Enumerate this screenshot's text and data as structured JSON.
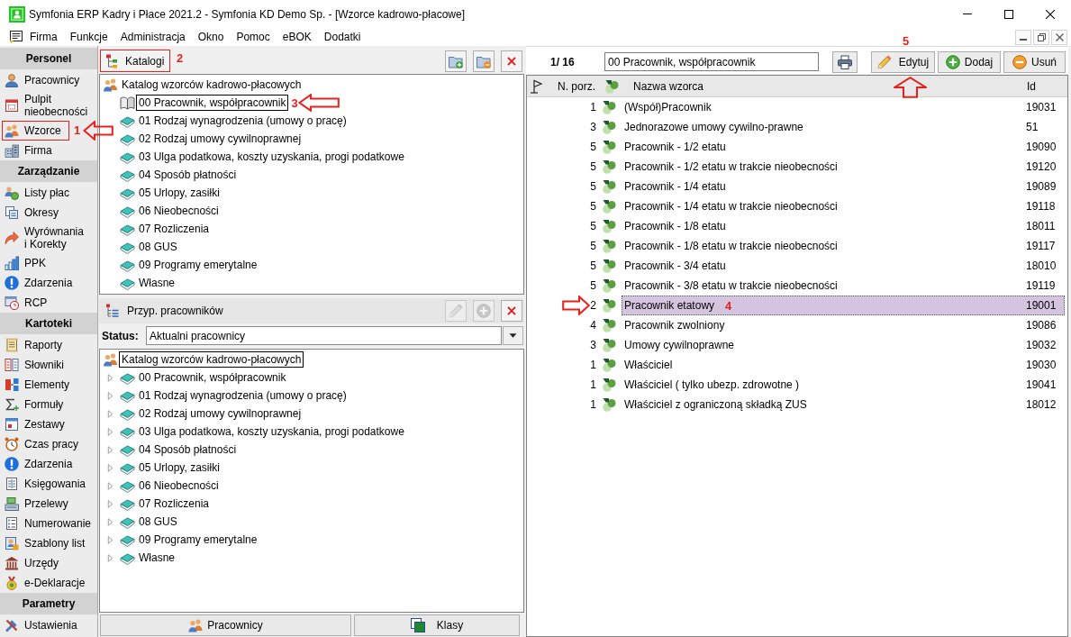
{
  "window": {
    "title": "Symfonia ERP Kadry i Płace 2021.2 - Symfonia KD Demo Sp. - [Wzorce kadrowo-płacowe]"
  },
  "menu": [
    "Firma",
    "Funkcje",
    "Administracja",
    "Okno",
    "Pomoc",
    "eBOK",
    "Dodatki"
  ],
  "sidebar": [
    {
      "title": "Personel",
      "items": [
        {
          "label": "Pracownicy"
        },
        {
          "label": "Pulpit\nnieobecności"
        },
        {
          "label": "Wzorce",
          "annotation": "1"
        },
        {
          "label": "Firma"
        }
      ]
    },
    {
      "title": "Zarządzanie",
      "items": [
        {
          "label": "Listy płac"
        },
        {
          "label": "Okresy"
        },
        {
          "label": "Wyrównania\ni Korekty"
        },
        {
          "label": "PPK"
        },
        {
          "label": "Zdarzenia"
        },
        {
          "label": "RCP"
        }
      ]
    },
    {
      "title": "Kartoteki",
      "items": [
        {
          "label": "Raporty"
        },
        {
          "label": "Słowniki"
        },
        {
          "label": "Elementy"
        },
        {
          "label": "Formuły"
        },
        {
          "label": "Zestawy"
        },
        {
          "label": "Czas pracy"
        },
        {
          "label": "Zdarzenia"
        },
        {
          "label": "Księgowania"
        },
        {
          "label": "Przelewy"
        },
        {
          "label": "Numerowanie"
        },
        {
          "label": "Szablony list"
        },
        {
          "label": "Urzędy"
        },
        {
          "label": "e-Deklaracje"
        }
      ]
    },
    {
      "title": "Parametry",
      "items": [
        {
          "label": "Ustawienia"
        }
      ]
    }
  ],
  "catalog_panel": {
    "tab": {
      "label": "Katalogi",
      "annotation": "2"
    },
    "tools": [
      {
        "kind": "add-folder",
        "disabled": false
      },
      {
        "kind": "remove-folder",
        "disabled": false
      },
      {
        "kind": "delete",
        "disabled": false
      }
    ],
    "tree": [
      {
        "label": "Katalog wzorców kadrowo-płacowych",
        "selected": false,
        "children": [
          {
            "label": "00 Pracownik, współpracownik",
            "selected": true,
            "annotation": "3"
          },
          {
            "label": "01 Rodzaj wynagrodzenia (umowy o pracę)",
            "selected": false
          },
          {
            "label": "02 Rodzaj umowy cywilnoprawnej",
            "selected": false
          },
          {
            "label": "03 Ulga podatkowa, koszty uzyskania, progi podatkowe",
            "selected": false
          },
          {
            "label": "04 Sposób płatności",
            "selected": false
          },
          {
            "label": "05 Urlopy, zasiłki",
            "selected": false
          },
          {
            "label": "06 Nieobecności",
            "selected": false
          },
          {
            "label": "07 Rozliczenia",
            "selected": false
          },
          {
            "label": "08 GUS",
            "selected": false
          },
          {
            "label": "09 Programy emerytalne",
            "selected": false
          },
          {
            "label": "Własne",
            "selected": false
          }
        ]
      }
    ]
  },
  "assignment_panel": {
    "title": "Przyp. pracowników",
    "tools": [
      {
        "kind": "edit",
        "disabled": true
      },
      {
        "kind": "add",
        "disabled": true
      },
      {
        "kind": "delete",
        "disabled": false
      }
    ],
    "status": {
      "label": "Status:",
      "value": "Aktualni pracownicy"
    },
    "tree": [
      {
        "label": "Katalog wzorców kadrowo-płacowych",
        "selected": true,
        "children": [
          {
            "label": "00 Pracownik, współpracownik",
            "selected": false,
            "expanded": false
          },
          {
            "label": "01 Rodzaj wynagrodzenia (umowy o pracę)",
            "selected": false,
            "expanded": false
          },
          {
            "label": "02 Rodzaj umowy cywilnoprawnej",
            "selected": false,
            "expanded": false
          },
          {
            "label": "03 Ulga podatkowa, koszty uzyskania, progi podatkowe",
            "selected": false,
            "expanded": false
          },
          {
            "label": "04 Sposób płatności",
            "selected": false,
            "expanded": false
          },
          {
            "label": "05 Urlopy, zasiłki",
            "selected": false,
            "expanded": false
          },
          {
            "label": "06 Nieobecności",
            "selected": false,
            "expanded": false
          },
          {
            "label": "07 Rozliczenia",
            "selected": false,
            "expanded": false
          },
          {
            "label": "08 GUS",
            "selected": false,
            "expanded": false
          },
          {
            "label": "09 Programy emerytalne",
            "selected": false,
            "expanded": false
          },
          {
            "label": "Własne",
            "selected": false,
            "expanded": false
          }
        ]
      }
    ],
    "buttons": [
      {
        "kind": "people",
        "label": "Pracownicy"
      },
      {
        "kind": "classes",
        "label": "Klasy"
      }
    ]
  },
  "templates_panel": {
    "counter": "1/ 16",
    "current_catalog": "00 Pracownik, współpracownik",
    "buttons": [
      {
        "kind": "print"
      },
      {
        "kind": "edit",
        "label": "Edytuj",
        "annotation": "5"
      },
      {
        "kind": "add",
        "label": "Dodaj"
      },
      {
        "kind": "remove",
        "label": "Usuń"
      }
    ],
    "table": {
      "columns": [
        {
          "kind": "flag"
        },
        {
          "kind": "text",
          "label": "N. porz."
        },
        {
          "kind": "dots"
        },
        {
          "kind": "text",
          "label": "Nazwa wzorca"
        },
        {
          "kind": "text",
          "label": "Id"
        }
      ],
      "rows": [
        {
          "order": "1",
          "name": "(Współ)Pracownik",
          "id": "19031",
          "selected": false
        },
        {
          "order": "3",
          "name": "Jednorazowe umowy cywilno-prawne",
          "id": "51",
          "selected": false
        },
        {
          "order": "5",
          "name": "Pracownik - 1/2 etatu",
          "id": "19090",
          "selected": false
        },
        {
          "order": "5",
          "name": "Pracownik - 1/2 etatu w trakcie nieobecności",
          "id": "19120",
          "selected": false
        },
        {
          "order": "5",
          "name": "Pracownik - 1/4 etatu",
          "id": "19089",
          "selected": false
        },
        {
          "order": "5",
          "name": "Pracownik - 1/4 etatu w trakcie nieobecności",
          "id": "19118",
          "selected": false
        },
        {
          "order": "5",
          "name": "Pracownik - 1/8 etatu",
          "id": "18011",
          "selected": false
        },
        {
          "order": "5",
          "name": "Pracownik - 1/8 etatu w trakcie nieobecności",
          "id": "19117",
          "selected": false
        },
        {
          "order": "5",
          "name": "Pracownik - 3/4 etatu",
          "id": "18010",
          "selected": false
        },
        {
          "order": "5",
          "name": "Pracownik - 3/8 etatu w trakcie nieobecności",
          "id": "19119",
          "selected": false
        },
        {
          "order": "2",
          "name": "Pracownik etatowy",
          "id": "19001",
          "selected": true,
          "annotation": "4"
        },
        {
          "order": "4",
          "name": "Pracownik zwolniony",
          "id": "19086",
          "selected": false
        },
        {
          "order": "3",
          "name": "Umowy cywilnoprawne",
          "id": "19032",
          "selected": false
        },
        {
          "order": "1",
          "name": "Właściciel",
          "id": "19030",
          "selected": false
        },
        {
          "order": "1",
          "name": "Właściciel ( tylko ubezp. zdrowotne )",
          "id": "19041",
          "selected": false
        },
        {
          "order": "1",
          "name": "Właściciel z ograniczoną składką ZUS",
          "id": "18012",
          "selected": false
        }
      ]
    }
  }
}
